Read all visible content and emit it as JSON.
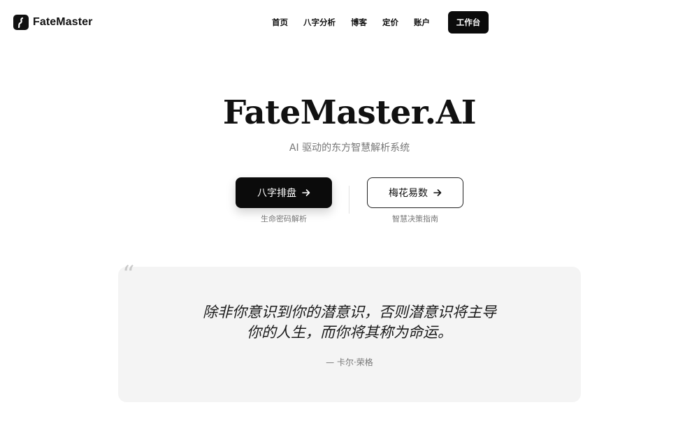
{
  "brand": {
    "name": "FateMaster",
    "icon": "fate-logo-icon"
  },
  "nav": {
    "items": [
      "首页",
      "八字分析",
      "博客",
      "定价",
      "账户"
    ],
    "cta_label": "工作台"
  },
  "hero": {
    "title": "FateMaster.AI",
    "subtitle": "AI 驱动的东方智慧解析系统"
  },
  "actions": [
    {
      "label": "八字排盘",
      "caption": "生命密码解析",
      "icon": "arrow-right-icon",
      "style": "dark"
    },
    {
      "label": "梅花易数",
      "caption": "智慧决策指南",
      "icon": "arrow-right-icon",
      "style": "outline"
    }
  ],
  "quote": {
    "mark": "“",
    "lines": [
      "除非你意识到你的潜意识，否则潜意识将主导",
      "你的人生，而你将其称为命运。"
    ],
    "author": "— 卡尔·荣格"
  },
  "colors": {
    "accent": "#0b0b0b",
    "muted_text": "#777777",
    "card_bg": "#f4f4f4"
  }
}
